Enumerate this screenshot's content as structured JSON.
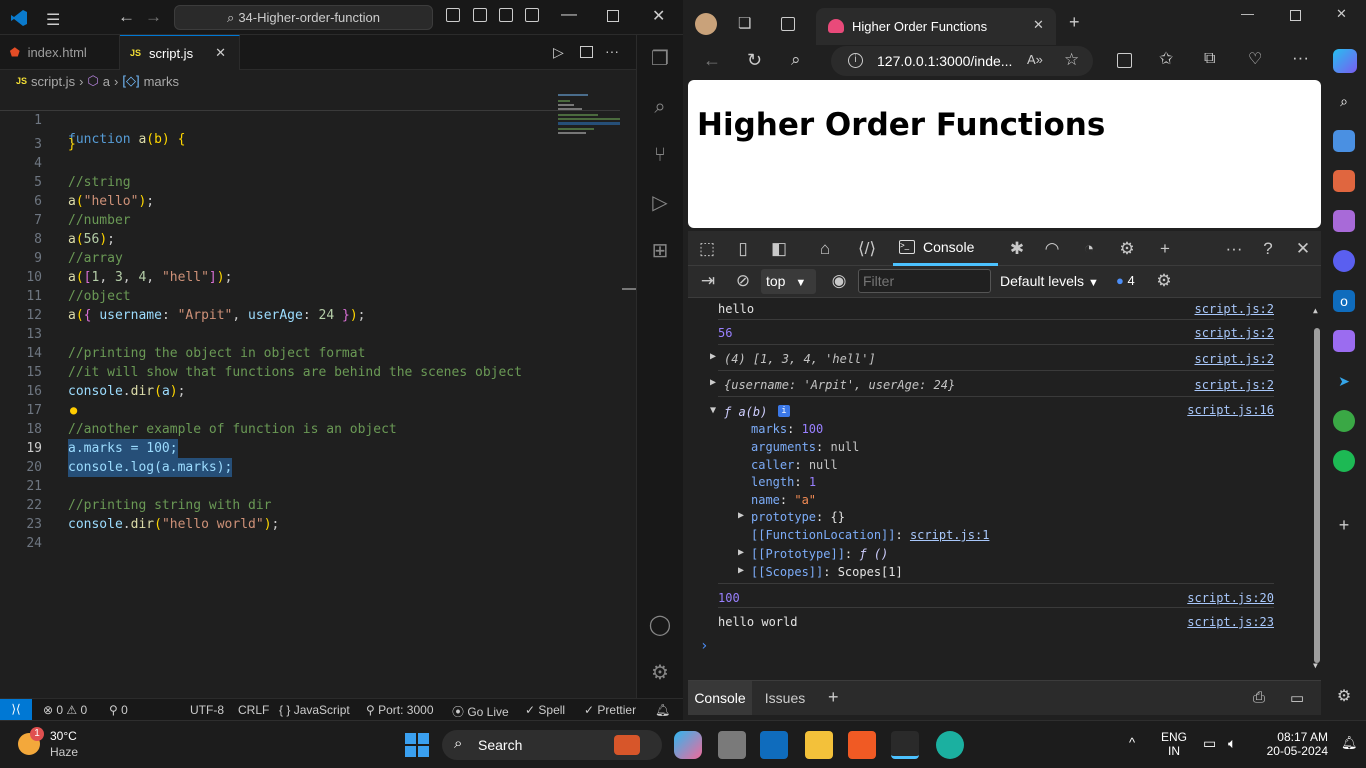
{
  "vscode": {
    "search_title": "34-Higher-order-function",
    "tabs": [
      {
        "label": "index.html",
        "icon": "html5-icon",
        "active": false
      },
      {
        "label": "script.js",
        "icon": "js-icon",
        "active": true
      }
    ],
    "breadcrumb": [
      "script.js",
      "a",
      "marks"
    ],
    "lines": [
      {
        "n": "1"
      },
      {
        "n": "3"
      },
      {
        "n": "4"
      },
      {
        "n": "5"
      },
      {
        "n": "6"
      },
      {
        "n": "7"
      },
      {
        "n": "8"
      },
      {
        "n": "9"
      },
      {
        "n": "10"
      },
      {
        "n": "11"
      },
      {
        "n": "12"
      },
      {
        "n": "13"
      },
      {
        "n": "14"
      },
      {
        "n": "15"
      },
      {
        "n": "16"
      },
      {
        "n": "17"
      },
      {
        "n": "18"
      },
      {
        "n": "19"
      },
      {
        "n": "20"
      },
      {
        "n": "21"
      },
      {
        "n": "22"
      },
      {
        "n": "23"
      },
      {
        "n": "24"
      }
    ],
    "code": {
      "l1_kw": "function",
      "l1_fn": " a",
      "l1_rest": "(b) {",
      "l3": "}",
      "l5": "//string",
      "l6_fn": "a",
      "l6_str": "\"hello\"",
      "l7": "//number",
      "l8_fn": "a",
      "l8_num": "56",
      "l9": "//array",
      "l10_fn": "a",
      "l10_nums": [
        "1",
        "3",
        "4"
      ],
      "l10_str": "\"hell\"",
      "l11": "//object",
      "l12_fn": "a",
      "l12_k1": "username",
      "l12_v1": "\"Arpit\"",
      "l12_k2": "userAge",
      "l12_v2": "24",
      "l14": "//printing the object in object format",
      "l15": "//it will show that functions are behind the scenes object",
      "l16_obj": "console",
      "l16_fn": "dir",
      "l16_arg": "a",
      "l18": "//another example of function is an object",
      "l19": "a.marks = 100;",
      "l20": "console.log(a.marks);",
      "l22": "//printing string with dir",
      "l23_obj": "console",
      "l23_fn": "dir",
      "l23_str": "\"hello world\""
    },
    "status": {
      "errors": "0",
      "warnings": "0",
      "ports": "0",
      "encoding": "UTF-8",
      "eol": "CRLF",
      "language": "JavaScript",
      "port": "Port: 3000",
      "golive": "Go Live",
      "spell": "Spell",
      "prettier": "Prettier"
    }
  },
  "edge": {
    "tab_title": "Higher Order Functions",
    "url": "127.0.0.1:3000/inde...",
    "page_heading": "Higher Order Functions",
    "devtools": {
      "console_tab": "Console",
      "context": "top",
      "filter_placeholder": "Filter",
      "levels": "Default levels",
      "issues_count": "4",
      "messages": [
        {
          "text": "hello",
          "src": "script.js:2"
        },
        {
          "text": "56",
          "src": "script.js:2"
        },
        {
          "text": "(4) [1, 3, 4, 'hell']",
          "src": "script.js:2"
        },
        {
          "text": "{username: 'Arpit', userAge: 24}",
          "src": "script.js:2"
        },
        {
          "text": "ƒ a(b)",
          "src": "script.js:16"
        },
        {
          "text": "100",
          "src": "script.js:20"
        },
        {
          "text": "hello world",
          "src": "script.js:23"
        }
      ],
      "fn_props": {
        "marks": "100",
        "arguments": "null",
        "caller": "null",
        "length": "1",
        "name": "\"a\"",
        "prototype": "{}",
        "function_location": "script.js:1",
        "proto": "ƒ ()",
        "scopes": "Scopes[1]"
      },
      "bottom_tabs": [
        "Console",
        "Issues"
      ]
    }
  },
  "taskbar": {
    "weather_temp": "30°C",
    "weather_desc": "Haze",
    "weather_badge": "1",
    "search": "Search",
    "lang": "ENG",
    "region": "IN",
    "time": "08:17 AM",
    "date": "20-05-2024"
  }
}
